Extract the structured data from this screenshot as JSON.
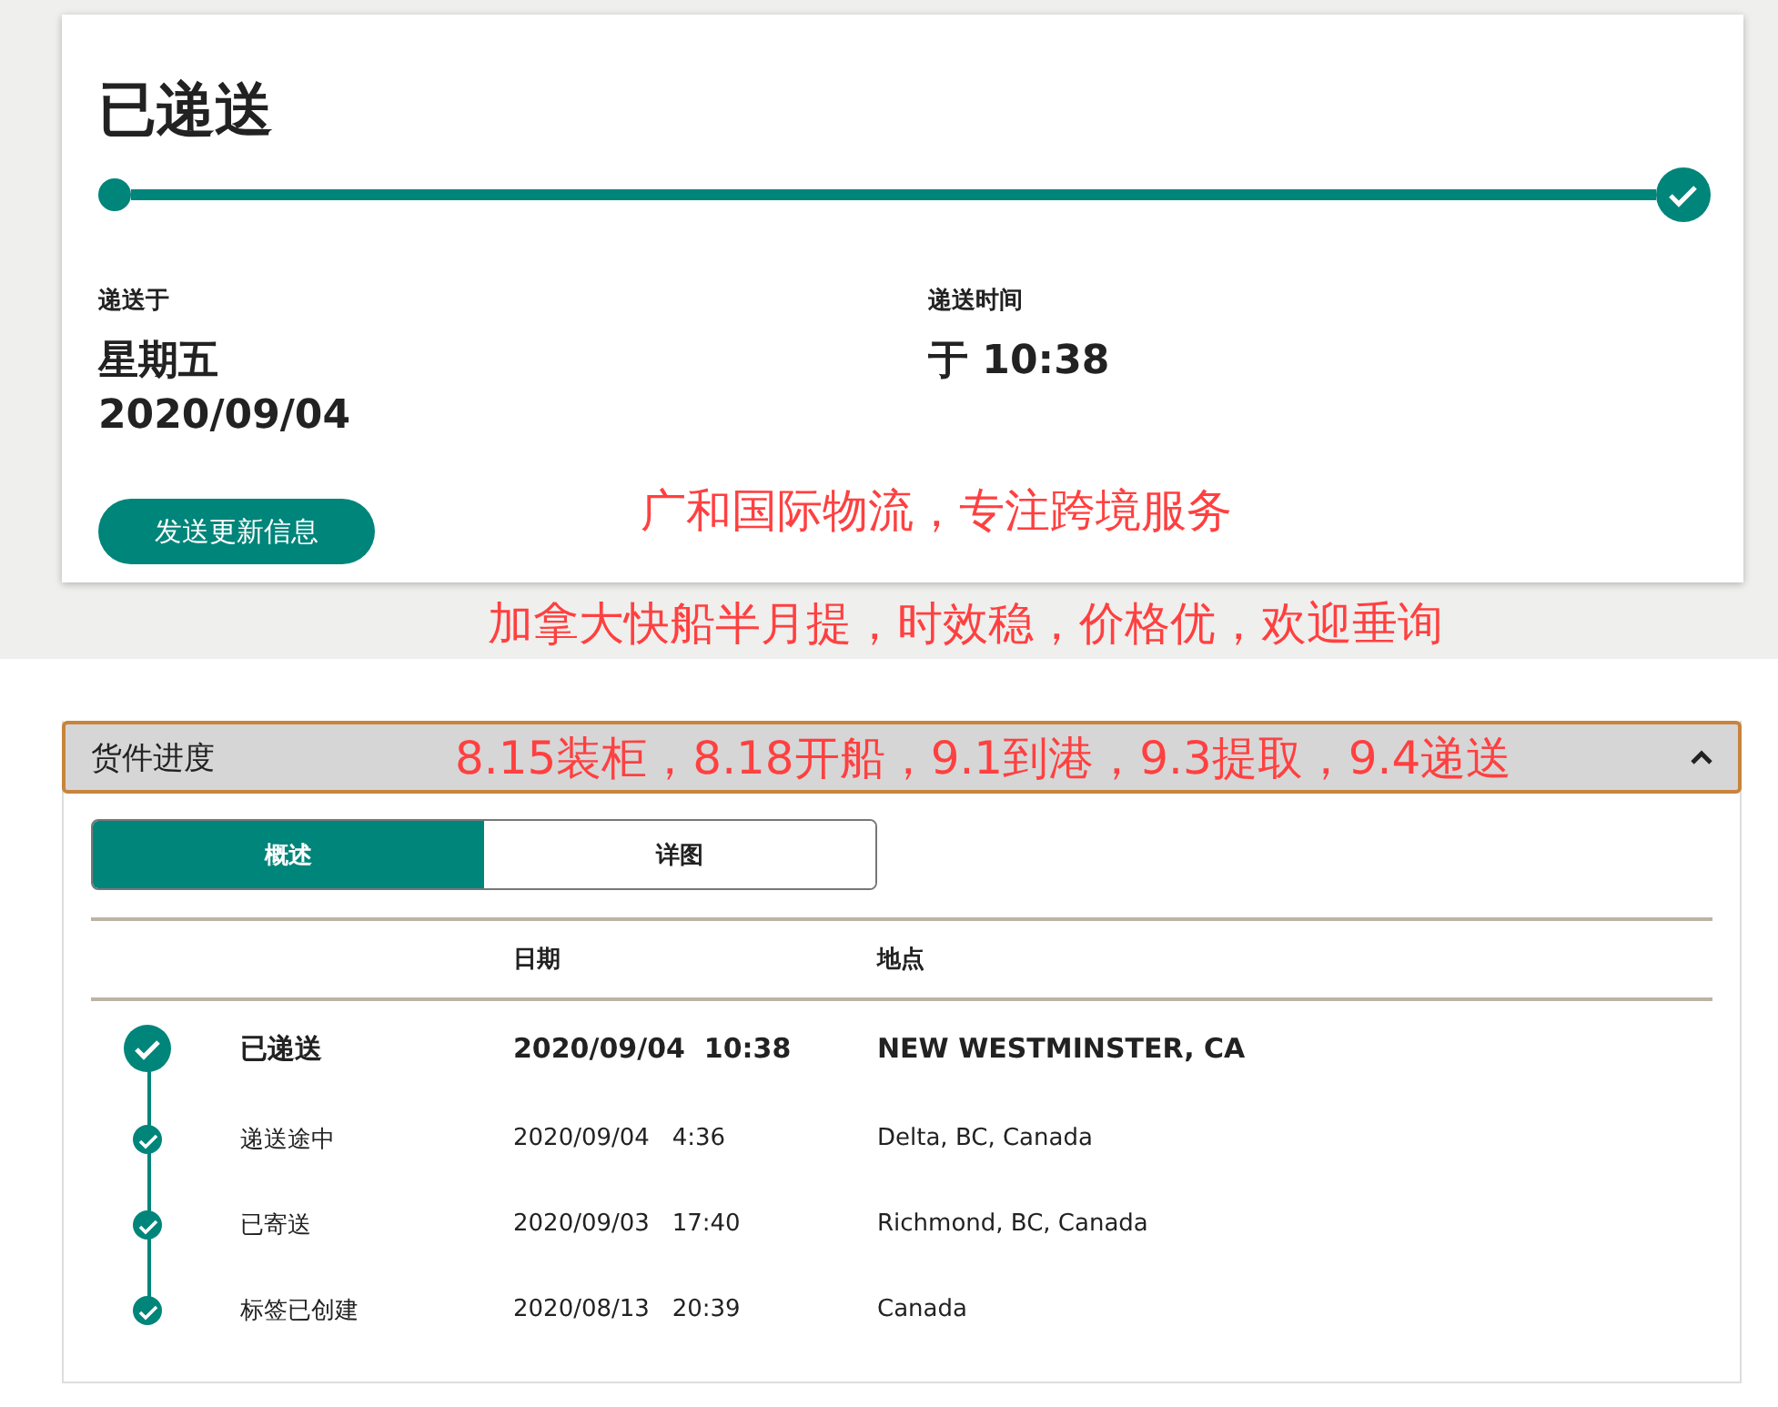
{
  "summary": {
    "title": "已递送",
    "progress": {
      "level": 1
    },
    "delivered_on": {
      "label": "递送于",
      "weekday": "星期五",
      "date": "2020/09/04"
    },
    "delivery_time": {
      "label": "递送时间",
      "value": "于 10:38"
    },
    "button": "发送更新信息"
  },
  "annotations": [
    "广和国际物流，专注跨境服务",
    "加拿大快船半月提，时效稳，价格优，欢迎垂询",
    "8.15装柜，8.18开船，9.1到港，9.3提取，9.4递送"
  ],
  "progress_panel": {
    "title": "货件进度",
    "expanded": true,
    "tabs": [
      {
        "label": "概述",
        "selected": true
      },
      {
        "label": "详图",
        "selected": false
      }
    ],
    "columns": [
      "日期",
      "地点"
    ],
    "rows": [
      {
        "status": "已递送",
        "date": "2020/09/04  10:38",
        "location": "NEW WESTMINSTER, CA",
        "current": true
      },
      {
        "status": "递送途中",
        "date": "2020/09/04   4:36",
        "location": "Delta, BC, Canada",
        "current": false
      },
      {
        "status": "已寄送",
        "date": "2020/09/03   17:40",
        "location": "Richmond, BC, Canada",
        "current": false
      },
      {
        "status": "标签已创建",
        "date": "2020/08/13   20:39",
        "location": "Canada",
        "current": false
      }
    ]
  }
}
